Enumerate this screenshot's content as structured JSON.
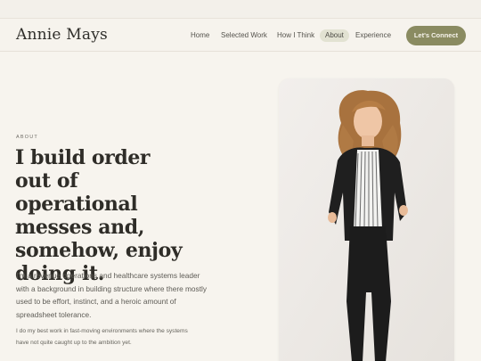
{
  "site": {
    "brand": "Annie Mays"
  },
  "nav": {
    "items": [
      {
        "label": "Home"
      },
      {
        "label": "Selected Work"
      },
      {
        "label": "How I Think"
      },
      {
        "label": "About",
        "active": true
      },
      {
        "label": "Experience"
      }
    ],
    "cta_label": "Let's Connect"
  },
  "hero": {
    "eyebrow": "ABOUT",
    "headline": "I build order out of operational messes and, somehow, enjoy doing it.",
    "intro": "I'm a revenue operations and healthcare systems leader with a background in building structure where there mostly used to be effort, instinct, and a heroic amount of spreadsheet tolerance.",
    "body": "I do my best work in fast-moving environments where the systems have not quite caught up to the ambition yet."
  },
  "photo": {
    "subject": "portrait-photo"
  },
  "colors": {
    "background": "#f7f4ee",
    "accent": "#8a8b61",
    "active_pill": "#e2e2d2",
    "text_dark": "#2f2d28"
  }
}
